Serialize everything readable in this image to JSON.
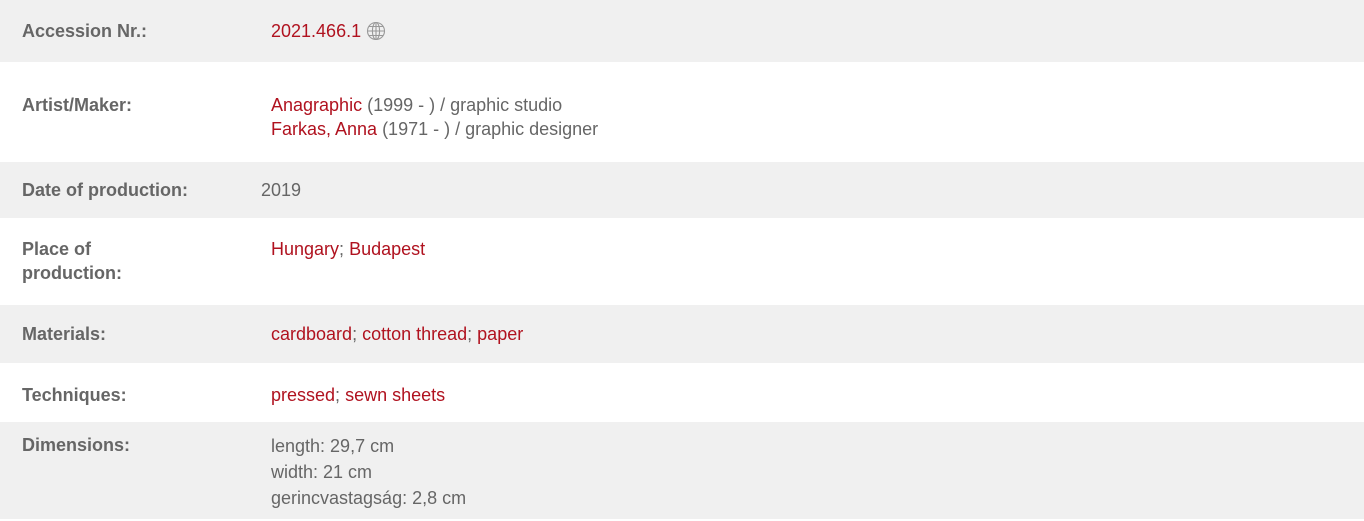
{
  "record": {
    "accession": {
      "label": "Accession Nr.:",
      "value": "2021.466.1",
      "icon": "globe-icon"
    },
    "artist": {
      "label": "Artist/Maker:",
      "makers": [
        {
          "name": "Anagraphic",
          "details": " (1999 - ) / graphic studio"
        },
        {
          "name": "Farkas, Anna",
          "details": " (1971 - ) / graphic designer"
        }
      ]
    },
    "date": {
      "label": "Date of production:",
      "value": "2019"
    },
    "place": {
      "label": "Place of production:",
      "items": [
        "Hungary",
        "Budapest"
      ],
      "separator": "; "
    },
    "materials": {
      "label": "Materials:",
      "items": [
        "cardboard",
        "cotton thread",
        "paper"
      ],
      "separator": "; "
    },
    "techniques": {
      "label": "Techniques:",
      "items": [
        "pressed",
        "sewn sheets"
      ],
      "separator": "; "
    },
    "dimensions": {
      "label": "Dimensions:",
      "lines": [
        "length: 29,7 cm",
        "width: 21 cm",
        "gerincvastagság: 2,8 cm"
      ]
    }
  },
  "colors": {
    "link": "#b0121f",
    "text": "#666666",
    "row_bg": "#f0f0f0"
  }
}
